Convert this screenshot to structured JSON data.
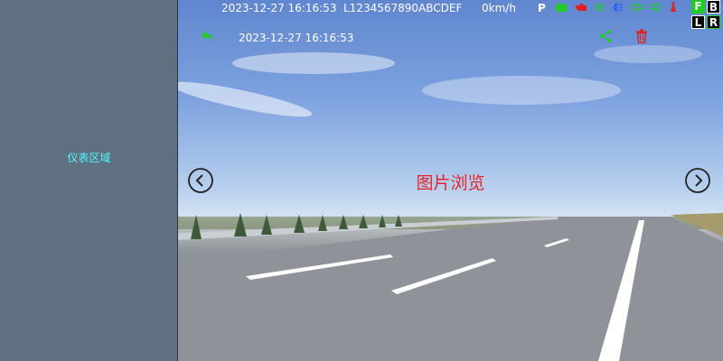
{
  "left_panel": {
    "label": "仪表区域"
  },
  "status_bar": {
    "datetime": "2023-12-27 16:16:53",
    "plate": "L1234567890ABCDEF",
    "speed": "0km/h",
    "gear": "P",
    "icons": [
      "battery-icon",
      "engine-warning-icon",
      "low-beam-icon",
      "high-beam-icon",
      "left-turn-icon",
      "right-turn-icon",
      "seatbelt-icon"
    ],
    "fblr": {
      "front": "F",
      "back": "B",
      "left": "L",
      "right": "R"
    }
  },
  "viewer": {
    "title": "图片浏览",
    "photo_timestamp": "2023-12-27 16:16:53",
    "colors": {
      "accent_green": "#22cc22",
      "delete_red": "#e02020",
      "title_red": "#e8232b"
    }
  }
}
